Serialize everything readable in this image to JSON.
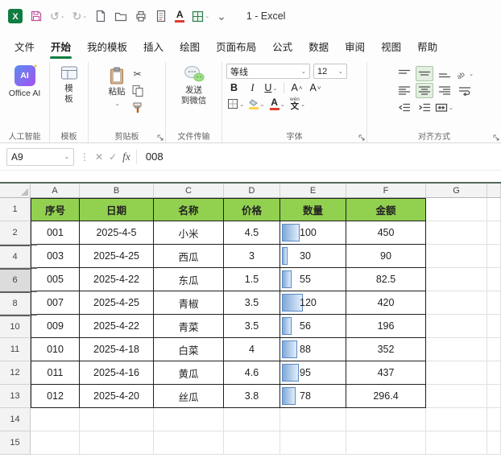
{
  "app": {
    "title": "1 - Excel"
  },
  "icons": {
    "caret_down": "⌄",
    "undo": "↺",
    "redo": "↻",
    "scissors": "✂",
    "check": "✓",
    "cancel": "✕",
    "dots": "⋮",
    "fx": "fx",
    "sparkle": "✦",
    "size_up_mark": "˄",
    "size_down_mark": "˅"
  },
  "tabs": {
    "items": [
      "文件",
      "开始",
      "我的模板",
      "插入",
      "绘图",
      "页面布局",
      "公式",
      "数据",
      "审阅",
      "视图",
      "帮助"
    ],
    "active_index": 1
  },
  "ribbon": {
    "groups": {
      "ai": {
        "button": "Office AI",
        "icon_text": "AI",
        "label": "人工智能"
      },
      "template": {
        "button": "模板",
        "label": "模板"
      },
      "clipboard": {
        "paste": "粘贴",
        "label": "剪贴板"
      },
      "transfer": {
        "line1": "发送",
        "line2": "到微信",
        "label": "文件传输"
      },
      "font": {
        "name": "等线",
        "size": "12",
        "bold": "B",
        "italic": "I",
        "underline": "U",
        "grow": "A",
        "shrink": "A",
        "color_glyph": "A",
        "fill_color": "#ffd34d",
        "font_color": "#e03c31",
        "pinyin_char": "文",
        "pinyin_mark": "wén",
        "label": "字体"
      },
      "align": {
        "label": "对齐方式"
      }
    }
  },
  "formula_bar": {
    "name_box": "A9",
    "value": "008"
  },
  "sheet": {
    "column_headers": [
      "A",
      "B",
      "C",
      "D",
      "E",
      "F",
      "G"
    ],
    "visible_rows": [
      1,
      2,
      4,
      6,
      8,
      10,
      11,
      12,
      13,
      14,
      15
    ],
    "rows_after_hidden": [
      4,
      6,
      8,
      10
    ],
    "header_row": [
      "序号",
      "日期",
      "名称",
      "价格",
      "数量",
      "金额"
    ],
    "data_rows": [
      {
        "row": 2,
        "cells": [
          "001",
          "2025-4-5",
          "小米",
          "4.5",
          "100",
          "450"
        ],
        "qty": 100
      },
      {
        "row": 4,
        "cells": [
          "003",
          "2025-4-25",
          "西瓜",
          "3",
          "30",
          "90"
        ],
        "qty": 30
      },
      {
        "row": 6,
        "cells": [
          "005",
          "2025-4-22",
          "东瓜",
          "1.5",
          "55",
          "82.5"
        ],
        "qty": 55
      },
      {
        "row": 8,
        "cells": [
          "007",
          "2025-4-25",
          "青椒",
          "3.5",
          "120",
          "420"
        ],
        "qty": 120
      },
      {
        "row": 10,
        "cells": [
          "009",
          "2025-4-22",
          "青菜",
          "3.5",
          "56",
          "196"
        ],
        "qty": 56
      },
      {
        "row": 11,
        "cells": [
          "010",
          "2025-4-18",
          "白菜",
          "4",
          "88",
          "352"
        ],
        "qty": 88
      },
      {
        "row": 12,
        "cells": [
          "011",
          "2025-4-16",
          "黄瓜",
          "4.6",
          "95",
          "437"
        ],
        "qty": 95
      },
      {
        "row": 13,
        "cells": [
          "012",
          "2025-4-20",
          "丝瓜",
          "3.8",
          "78",
          "296.4"
        ],
        "qty": 78
      }
    ],
    "qty_bar_max": 120,
    "colors": {
      "header_fill": "#92d050",
      "bar_fill_start": "#7fa8d9",
      "bar_fill_end": "#e4eefa",
      "bar_border": "#5b88c2",
      "accent_green": "#107c41"
    }
  }
}
